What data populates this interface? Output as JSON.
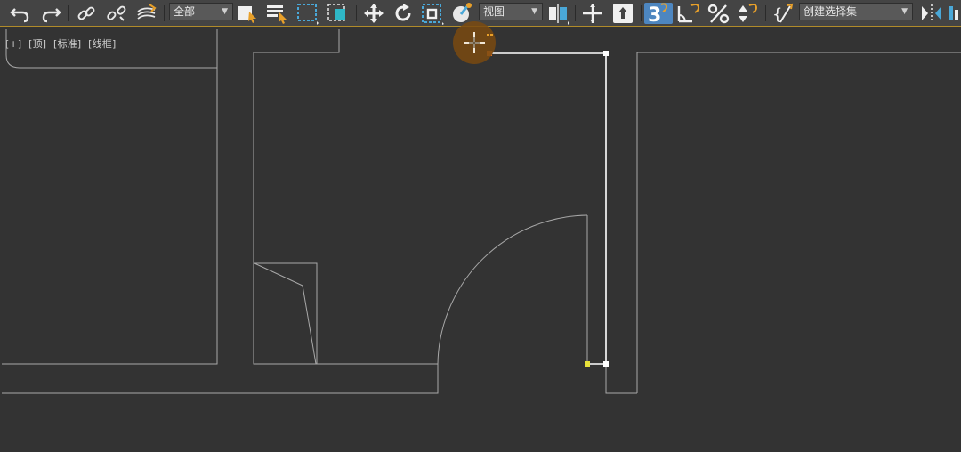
{
  "toolbar": {
    "selection_filter": "全部",
    "reference_coord": "视图",
    "named_selection_placeholder": "创建选择集",
    "snap_toggle_label": "3"
  },
  "viewport": {
    "labels": [
      "[+]",
      "[顶]",
      "[标准]",
      "[线框]"
    ]
  },
  "colors": {
    "background": "#333333",
    "toolbar": "#444444",
    "accent": "#4d86c0",
    "active_border": "#b08b2a",
    "wall_line": "#a8a8a8",
    "selected_spline": "#ffffff",
    "vertex_yellow": "#e8e23a",
    "cursor_highlight": "#7a4a10"
  },
  "icons": [
    "undo-icon",
    "redo-icon",
    "link-icon",
    "unlink-icon",
    "space-warp-icon",
    "select-object-icon",
    "select-by-name-icon",
    "rect-region-icon",
    "window-crossing-icon",
    "move-icon",
    "rotate-icon",
    "scale-icon",
    "place-icon",
    "pivot-icon",
    "mirror-axis-icon",
    "snap-3d-icon",
    "angle-snap-icon",
    "percent-snap-icon",
    "spinner-snap-icon",
    "edit-named-sets-icon",
    "mirror-icon"
  ]
}
